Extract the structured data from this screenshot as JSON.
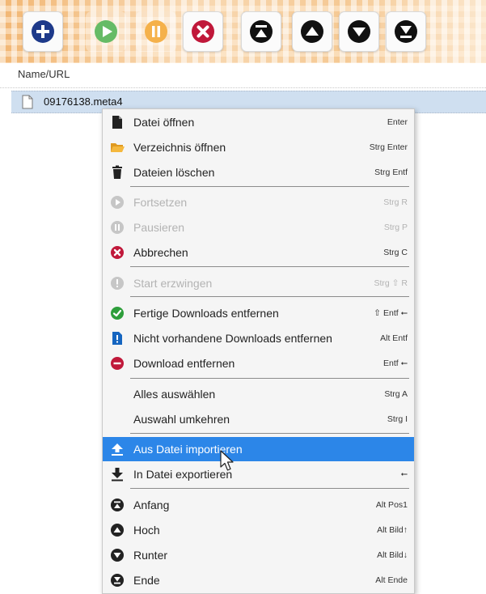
{
  "toolbar": {
    "buttons": [
      {
        "icon": "add-icon",
        "color": "#1e3a8a",
        "enabled": true
      },
      {
        "icon": "play-icon",
        "color": "#5cb85c",
        "enabled": false
      },
      {
        "icon": "pause-icon",
        "color": "#f5a623",
        "enabled": false
      },
      {
        "icon": "cancel-icon",
        "color": "#c0183a",
        "enabled": true
      },
      {
        "icon": "move-top-icon",
        "color": "#111111",
        "enabled": true
      },
      {
        "icon": "move-up-icon",
        "color": "#111111",
        "enabled": true
      },
      {
        "icon": "move-down-icon",
        "color": "#111111",
        "enabled": true
      },
      {
        "icon": "move-bottom-icon",
        "color": "#111111",
        "enabled": true
      }
    ]
  },
  "list": {
    "column_header": "Name/URL",
    "rows": [
      {
        "name": "09176138.meta4",
        "icon": "file-icon",
        "selected": true
      }
    ]
  },
  "menu": {
    "items": [
      {
        "label": "Datei öffnen",
        "shortcut": "Enter",
        "icon": "file-icon",
        "enabled": true
      },
      {
        "label": "Verzeichnis öffnen",
        "shortcut": "Strg Enter",
        "icon": "folder-icon",
        "enabled": true
      },
      {
        "label": "Dateien löschen",
        "shortcut": "Strg Entf",
        "icon": "trash-icon",
        "enabled": true
      },
      {
        "label": "Fortsetzen",
        "shortcut": "Strg R",
        "icon": "play-icon",
        "enabled": false
      },
      {
        "label": "Pausieren",
        "shortcut": "Strg P",
        "icon": "pause-icon",
        "enabled": false
      },
      {
        "label": "Abbrechen",
        "shortcut": "Strg C",
        "icon": "cancel-icon",
        "enabled": true
      },
      {
        "label": "Start erzwingen",
        "shortcut": "Strg ⇧ R",
        "icon": "exclamation-icon",
        "enabled": false
      },
      {
        "label": "Fertige Downloads entfernen",
        "shortcut": "⇧ Entf   ⭠",
        "icon": "check-icon",
        "enabled": true
      },
      {
        "label": "Nicht vorhandene Downloads entfernen",
        "shortcut": "Alt Entf",
        "icon": "missing-file-icon",
        "enabled": true
      },
      {
        "label": "Download entfernen",
        "shortcut": "Entf   ⭠",
        "icon": "remove-icon",
        "enabled": true
      },
      {
        "label": "Alles auswählen",
        "shortcut": "Strg A",
        "icon": "",
        "enabled": true
      },
      {
        "label": "Auswahl umkehren",
        "shortcut": "Strg I",
        "icon": "",
        "enabled": true
      },
      {
        "label": "Aus Datei importieren",
        "shortcut": "",
        "icon": "import-icon",
        "enabled": true,
        "highlighted": true
      },
      {
        "label": "In Datei exportieren",
        "shortcut": "⭠",
        "icon": "export-icon",
        "enabled": true
      },
      {
        "label": "Anfang",
        "shortcut": "Alt Pos1",
        "icon": "move-top-icon",
        "enabled": true
      },
      {
        "label": "Hoch",
        "shortcut": "Alt Bild↑",
        "icon": "move-up-icon",
        "enabled": true
      },
      {
        "label": "Runter",
        "shortcut": "Alt Bild↓",
        "icon": "move-down-icon",
        "enabled": true
      },
      {
        "label": "Ende",
        "shortcut": "Alt Ende",
        "icon": "move-bottom-icon",
        "enabled": true
      }
    ]
  },
  "colors": {
    "highlight": "#2c86e8",
    "selection": "#cfdff0",
    "danger": "#c0183a",
    "success": "#2e9e3b",
    "info": "#1565c0",
    "folder": "#f0a830",
    "disabled": "#c6c6c6"
  }
}
